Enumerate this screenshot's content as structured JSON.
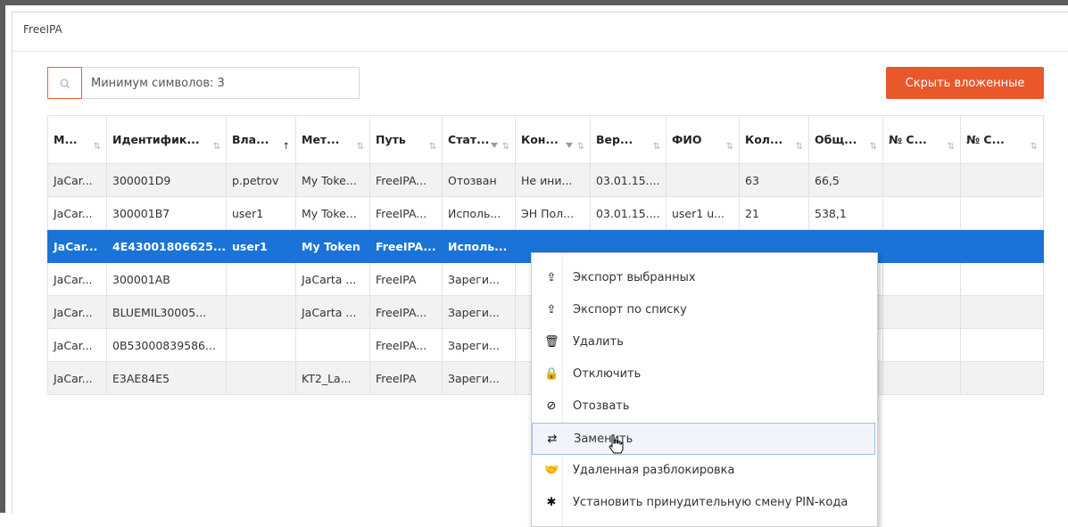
{
  "app": {
    "title": "FreeIPA"
  },
  "search": {
    "placeholder": "Минимум символов: 3",
    "value": ""
  },
  "toolbar": {
    "collapse_label": "Скрыть вложенные"
  },
  "colors": {
    "accent": "#e8582a",
    "selection": "#1a73d6",
    "search_focus": "#e8643a"
  },
  "table": {
    "columns": [
      {
        "label": "М...",
        "sort": "none",
        "filter": false
      },
      {
        "label": "Идентифик...",
        "sort": "none",
        "filter": false
      },
      {
        "label": "Вла...",
        "sort": "asc",
        "filter": false
      },
      {
        "label": "Мет...",
        "sort": "none",
        "filter": false
      },
      {
        "label": "Путь",
        "sort": "none",
        "filter": false
      },
      {
        "label": "Стат...",
        "sort": "none",
        "filter": true
      },
      {
        "label": "Кон...",
        "sort": "none",
        "filter": true
      },
      {
        "label": "Вер...",
        "sort": "none",
        "filter": false
      },
      {
        "label": "ФИО",
        "sort": "none",
        "filter": false
      },
      {
        "label": "Кол...",
        "sort": "none",
        "filter": false
      },
      {
        "label": "Общ...",
        "sort": "none",
        "filter": false
      },
      {
        "label": "№ С...",
        "sort": "none",
        "filter": false
      },
      {
        "label": "№ С...",
        "sort": "none",
        "filter": false
      }
    ],
    "rows": [
      {
        "selected": false,
        "cells": [
          "JaCar...",
          "300001D9",
          "p.petrov",
          "My Toke...",
          "FreeIPA...",
          "Отозван",
          "Не ини...",
          "03.01.15....",
          "",
          "63",
          "66,5",
          "",
          ""
        ]
      },
      {
        "selected": false,
        "cells": [
          "JaCar...",
          "300001B7",
          "user1",
          "My Toke...",
          "FreeIPA...",
          "Исполь...",
          "ЭН Пол...",
          "03.01.15....",
          "user1 u...",
          "21",
          "538,1",
          "",
          ""
        ]
      },
      {
        "selected": true,
        "cells": [
          "JaCar...",
          "4E43001806625...",
          "user1",
          "My Token",
          "FreeIPA...",
          "Исполь...",
          "",
          "",
          "",
          "",
          "",
          "",
          ""
        ]
      },
      {
        "selected": false,
        "cells": [
          "JaCar...",
          "300001AB",
          "",
          "JaCarta ...",
          "FreeIPA",
          "Зареги...",
          "",
          "",
          "",
          "",
          "",
          "",
          ""
        ]
      },
      {
        "selected": false,
        "cells": [
          "JaCar...",
          "BLUEMIL30005...",
          "",
          "JaCarta ...",
          "FreeIPA...",
          "Зареги...",
          "",
          "",
          "",
          "",
          "",
          "",
          ""
        ]
      },
      {
        "selected": false,
        "cells": [
          "JaCar...",
          "0B53000839586...",
          "",
          "",
          "FreeIPA...",
          "Зареги...",
          "",
          "",
          "",
          "",
          "",
          "",
          ""
        ]
      },
      {
        "selected": false,
        "cells": [
          "JaCar...",
          "E3AE84E5",
          "",
          "KT2_La...",
          "FreeIPA",
          "Зареги...",
          "",
          "",
          "",
          "",
          "",
          "",
          ""
        ]
      }
    ]
  },
  "context_menu": {
    "items": [
      {
        "icon": "upload-icon",
        "glyph": "⇪",
        "label": "Экспорт выбранных",
        "hovered": false
      },
      {
        "icon": "upload-list-icon",
        "glyph": "⇪",
        "label": "Экспорт по списку",
        "hovered": false
      },
      {
        "icon": "trash-icon",
        "glyph": "🗑",
        "label": "Удалить",
        "hovered": false
      },
      {
        "icon": "lock-icon",
        "glyph": "🔒",
        "label": "Отключить",
        "hovered": false
      },
      {
        "icon": "ban-icon",
        "glyph": "⊘",
        "label": "Отозвать",
        "hovered": false
      },
      {
        "icon": "swap-icon",
        "glyph": "⇄",
        "label": "Заменить",
        "hovered": true
      },
      {
        "icon": "handshake-icon",
        "glyph": "🤝",
        "label": "Удаленная разблокировка",
        "hovered": false
      },
      {
        "icon": "asterisk-icon",
        "glyph": "✱",
        "label": "Установить принудительную смену PIN-кода",
        "hovered": false
      }
    ]
  }
}
